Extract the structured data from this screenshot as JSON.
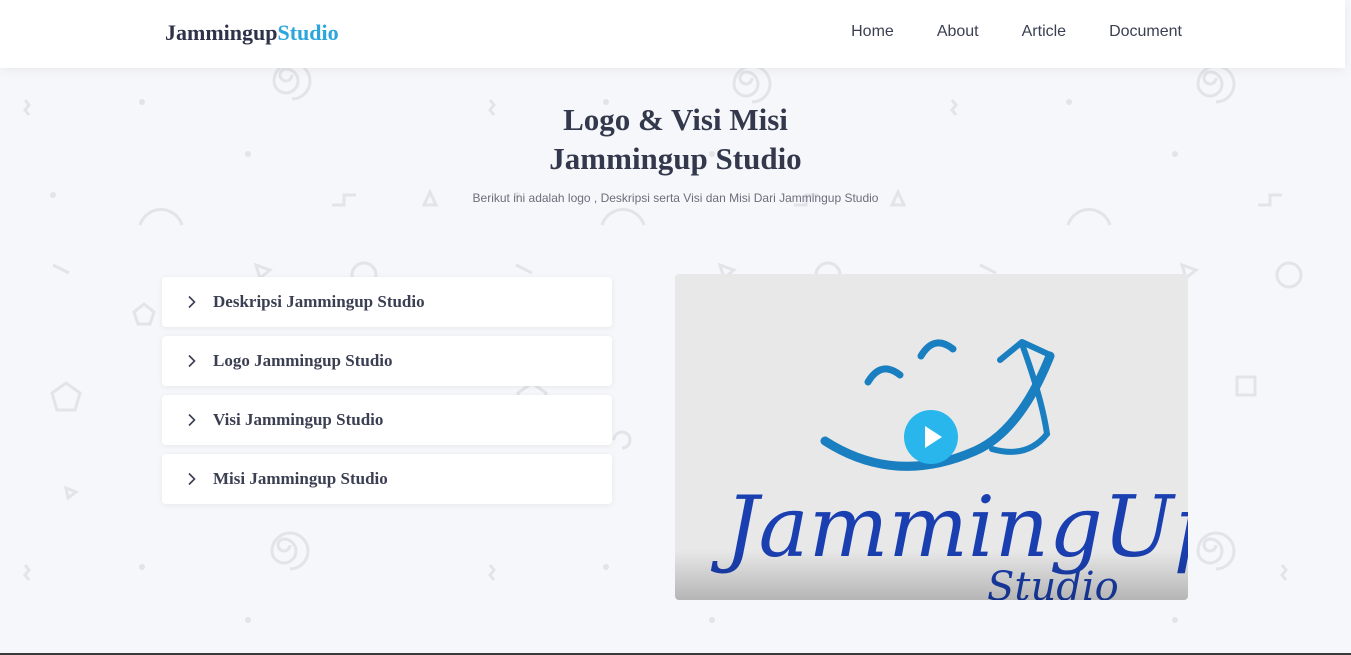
{
  "header": {
    "brand_part1": "Jammingup",
    "brand_part2": "Studio",
    "nav": [
      "Home",
      "About",
      "Article",
      "Document"
    ]
  },
  "hero": {
    "title_line1": "Logo & Visi Misi",
    "title_line2": "Jammingup Studio",
    "subtitle": "Berikut ini adalah logo , Deskripsi serta Visi dan Misi Dari Jammingup Studio"
  },
  "accordion": {
    "items": [
      "Deskripsi Jammingup Studio",
      "Logo Jammingup Studio",
      "Visi Jammingup Studio",
      "Misi Jammingup Studio"
    ],
    "icon": "chevron-right-icon"
  },
  "video": {
    "thumbnail_text_main": "JammingUp",
    "thumbnail_text_sub": "Studio",
    "play_icon": "play-icon"
  },
  "colors": {
    "accent": "#2aa6dc",
    "play_button": "#29b6ec",
    "text": "#3a3f52",
    "background": "#f6f7fa"
  }
}
